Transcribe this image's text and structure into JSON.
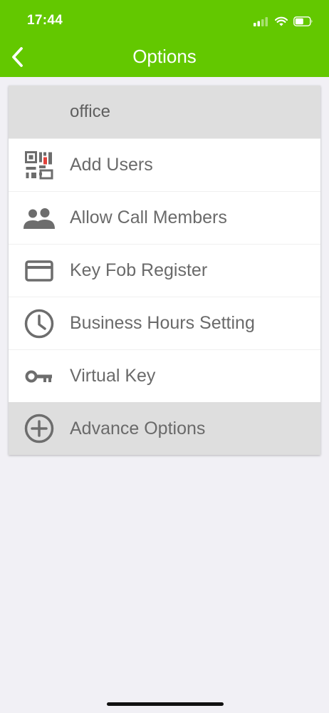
{
  "status_bar": {
    "time": "17:44"
  },
  "header": {
    "title": "Options"
  },
  "group": {
    "name": "office"
  },
  "menu": [
    {
      "label": "Add Users",
      "icon": "qr-code-icon"
    },
    {
      "label": "Allow Call Members",
      "icon": "people-icon"
    },
    {
      "label": "Key Fob Register",
      "icon": "card-icon"
    },
    {
      "label": "Business Hours Setting",
      "icon": "clock-icon"
    },
    {
      "label": "Virtual Key",
      "icon": "key-icon"
    }
  ],
  "advance": {
    "label": "Advance Options",
    "icon": "add-circle-icon"
  },
  "colors": {
    "accent": "#63c800",
    "icon": "#6d6d6d",
    "qr_highlight": "#e0403a"
  }
}
